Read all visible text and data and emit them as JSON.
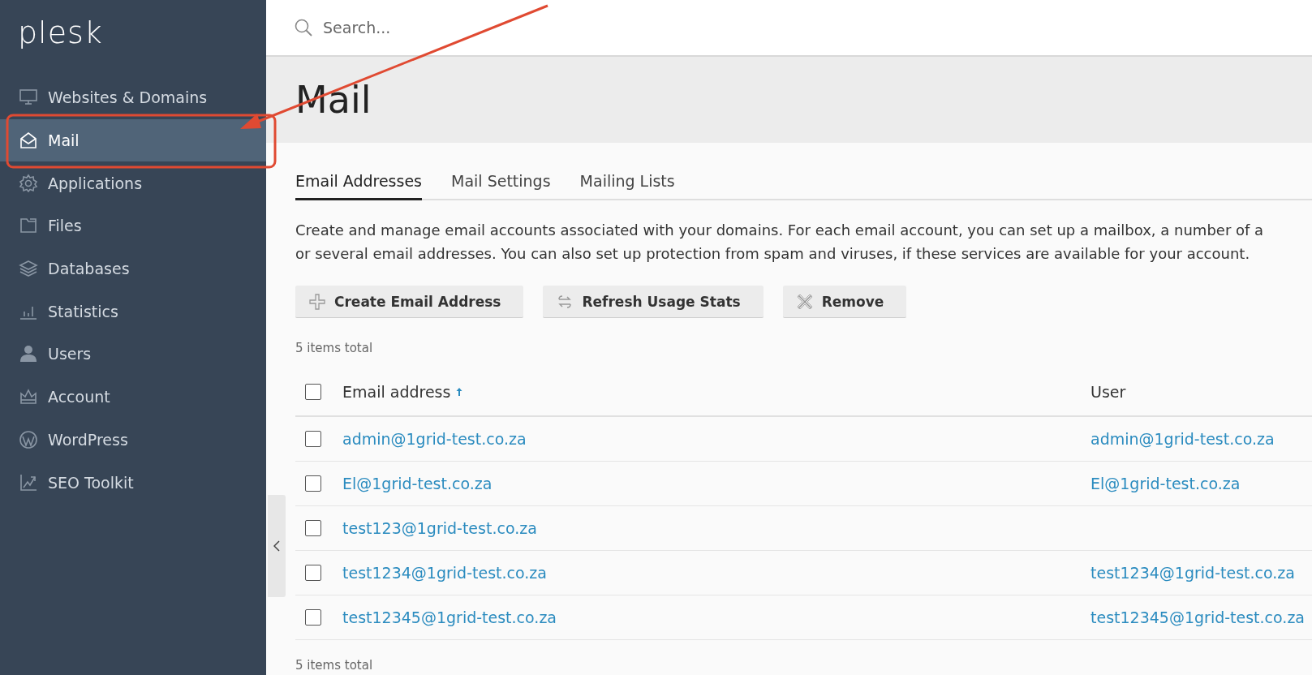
{
  "sidebar": {
    "logo": "plesk",
    "items": [
      {
        "label": "Websites & Domains",
        "selected": false
      },
      {
        "label": "Mail",
        "selected": true
      },
      {
        "label": "Applications",
        "selected": false
      },
      {
        "label": "Files",
        "selected": false
      },
      {
        "label": "Databases",
        "selected": false
      },
      {
        "label": "Statistics",
        "selected": false
      },
      {
        "label": "Users",
        "selected": false
      },
      {
        "label": "Account",
        "selected": false
      },
      {
        "label": "WordPress",
        "selected": false
      },
      {
        "label": "SEO Toolkit",
        "selected": false
      }
    ]
  },
  "search": {
    "placeholder": "Search..."
  },
  "page_title": "Mail",
  "tabs": [
    {
      "label": "Email Addresses",
      "selected": true
    },
    {
      "label": "Mail Settings",
      "selected": false
    },
    {
      "label": "Mailing Lists",
      "selected": false
    }
  ],
  "description_lines": [
    "Create and manage email accounts associated with your domains. For each email account, you can set up a mailbox, a number of a",
    "or several email addresses. You can also set up protection from spam and viruses, if these services are available for your account."
  ],
  "toolbar": [
    {
      "kind": "create",
      "label": "Create Email Address"
    },
    {
      "kind": "refresh",
      "label": "Refresh Usage Stats"
    },
    {
      "kind": "remove",
      "label": "Remove"
    }
  ],
  "items_total_top": "5 items total",
  "table": {
    "select_all_checked": false,
    "columns": [
      {
        "label": "Email address",
        "sorted_ascending": true
      },
      {
        "label": "User"
      }
    ],
    "rows": [
      {
        "checked": false,
        "email": "admin@1grid-test.co.za",
        "user": "admin@1grid-test.co.za"
      },
      {
        "checked": false,
        "email": "El@1grid-test.co.za",
        "user": "El@1grid-test.co.za"
      },
      {
        "checked": false,
        "email": "test123@1grid-test.co.za"
      },
      {
        "checked": false,
        "email": "test1234@1grid-test.co.za",
        "user": "test1234@1grid-test.co.za"
      },
      {
        "checked": false,
        "email": "test12345@1grid-test.co.za",
        "user": "test12345@1grid-test.co.za"
      }
    ]
  },
  "items_total_bottom": "5 items total"
}
